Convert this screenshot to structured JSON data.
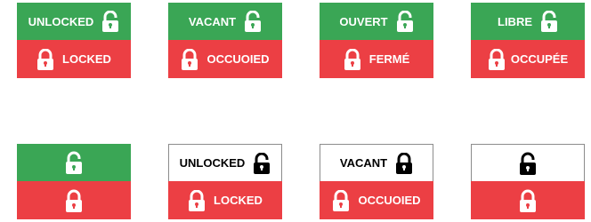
{
  "colors": {
    "unlocked_bg": "#3aa655",
    "locked_bg": "#ec3f44",
    "neutral_bg": "#ffffff",
    "border": "#8c8c8c"
  },
  "signs": [
    {
      "top_text": "UNLOCKED",
      "bottom_text": "LOCKED"
    },
    {
      "top_text": "VACANT",
      "bottom_text": "OCCUOIED"
    },
    {
      "top_text": "OUVERT",
      "bottom_text": "FERMÉ"
    },
    {
      "top_text": "LIBRE",
      "bottom_text": "OCCUPÉE"
    },
    {
      "top_text": "",
      "bottom_text": ""
    },
    {
      "top_text": "UNLOCKED",
      "bottom_text": "LOCKED"
    },
    {
      "top_text": "VACANT",
      "bottom_text": "OCCUOIED"
    },
    {
      "top_text": "",
      "bottom_text": ""
    }
  ]
}
